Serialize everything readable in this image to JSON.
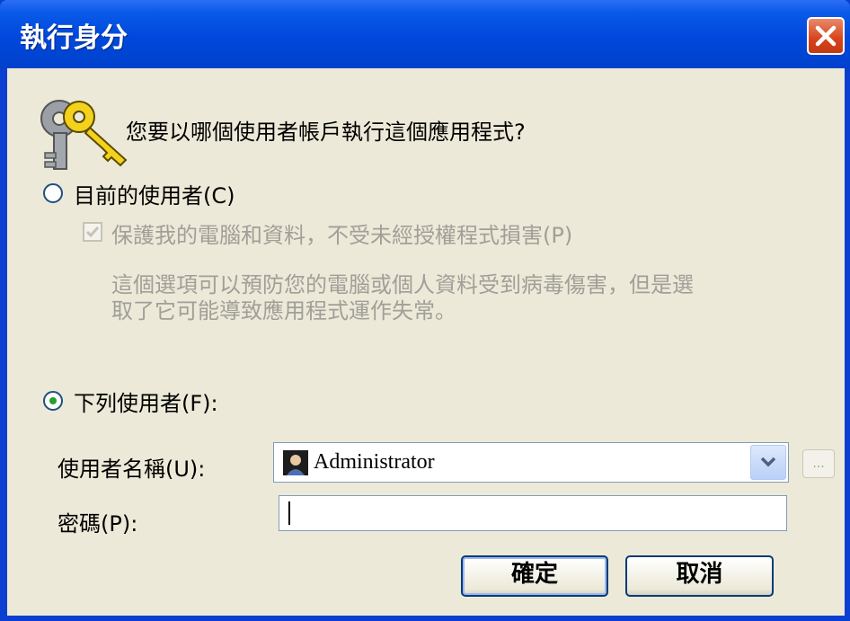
{
  "title": "執行身分",
  "header": {
    "question": "您要以哪個使用者帳戶執行這個應用程式?"
  },
  "options": {
    "current_user": {
      "label": "目前的使用者(C)",
      "selected": false
    },
    "protect": {
      "label": "保護我的電腦和資料，不受未經授權程式損害(P)",
      "checked": true,
      "enabled": false,
      "description_line1": "這個選項可以預防您的電腦或個人資料受到病毒傷害，但是選",
      "description_line2": "取了它可能導致應用程式運作失常。"
    },
    "following_user": {
      "label": "下列使用者(F):",
      "selected": true
    }
  },
  "form": {
    "username_label": "使用者名稱(U):",
    "username_value": "Administrator",
    "password_label": "密碼(P):",
    "password_value": "",
    "browse_label": "..."
  },
  "buttons": {
    "ok": "確定",
    "cancel": "取消"
  },
  "colors": {
    "title_bar": "#0048dc",
    "dialog_bg": "#ece9d8",
    "close": "#d6431c",
    "radio_dot": "#26a12c"
  },
  "icons": {
    "dialog": "keys-icon",
    "user": "user-account-icon"
  }
}
